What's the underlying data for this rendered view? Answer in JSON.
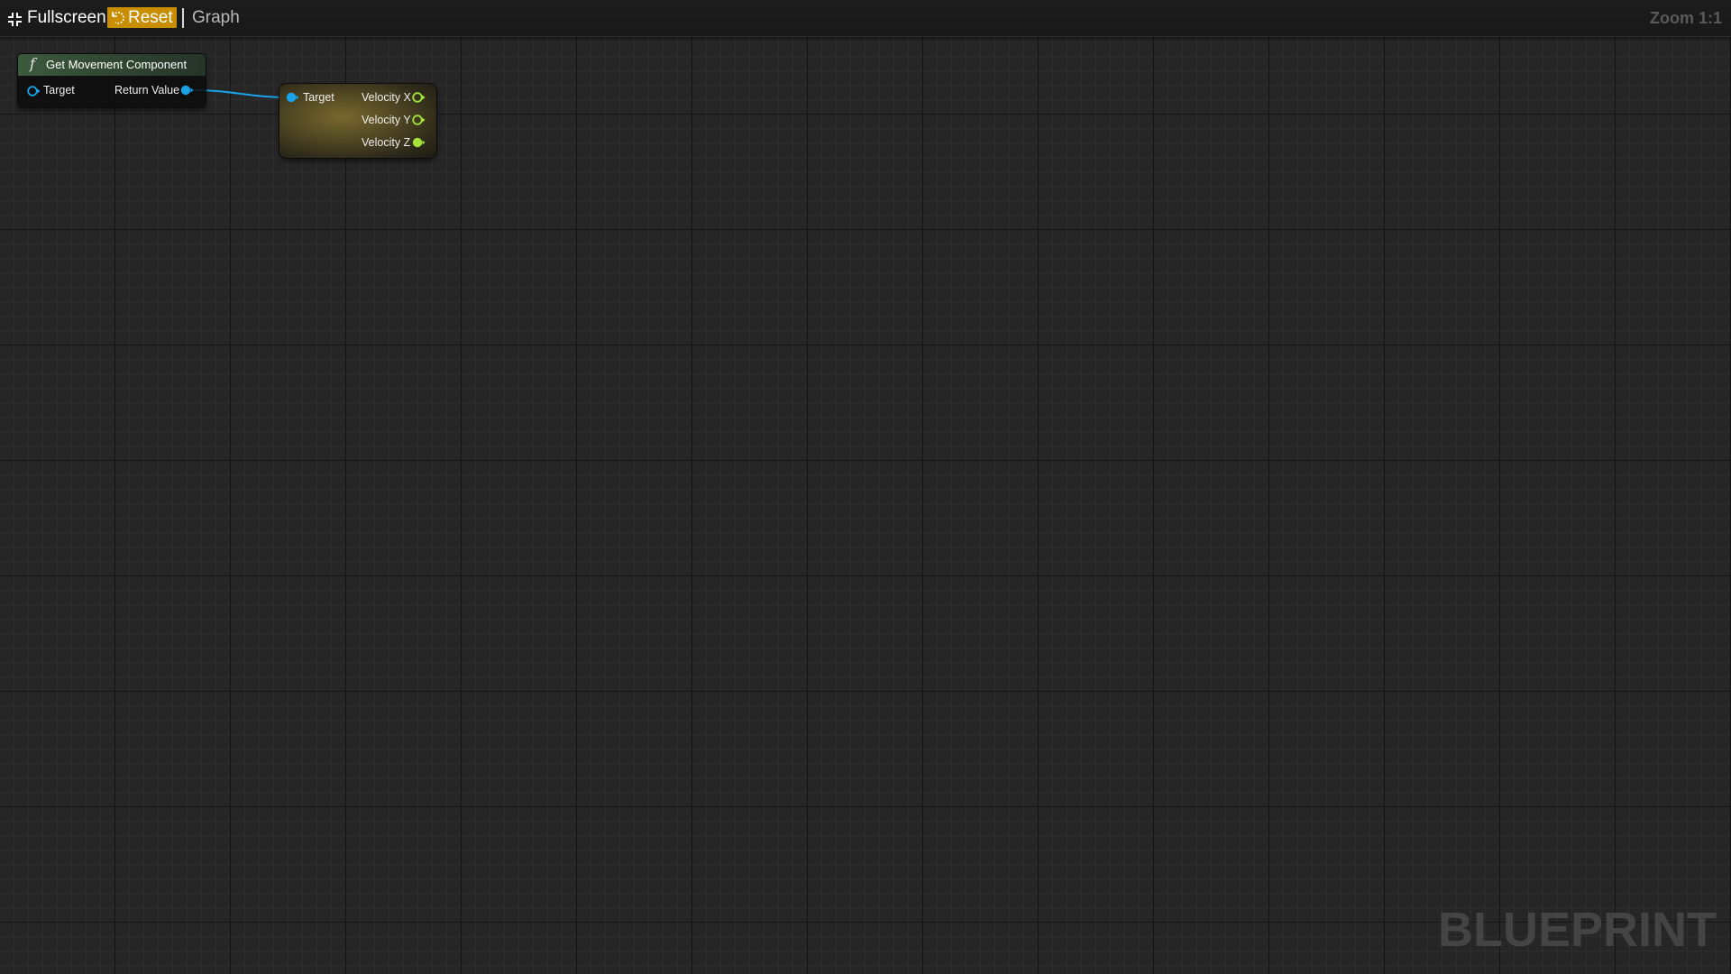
{
  "toolbar": {
    "fullscreen_label": "Fullscreen",
    "reset_label": "Reset",
    "graph_label": "Graph",
    "zoom_label": "Zoom 1:1"
  },
  "nodes": {
    "get_movement": {
      "icon": "function-icon",
      "title": "Get Movement Component",
      "input_pin": "Target",
      "output_pin": "Return Value"
    },
    "break_velocity": {
      "input_pin": "Target",
      "outputs": [
        "Velocity X",
        "Velocity Y",
        "Velocity Z"
      ]
    }
  },
  "watermark": "BLUEPRINT",
  "colors": {
    "object_pin": "#1aa3e8",
    "float_pin": "#a4e33c",
    "reset_button": "#c88e00",
    "function_header": "#3c5a3e"
  }
}
